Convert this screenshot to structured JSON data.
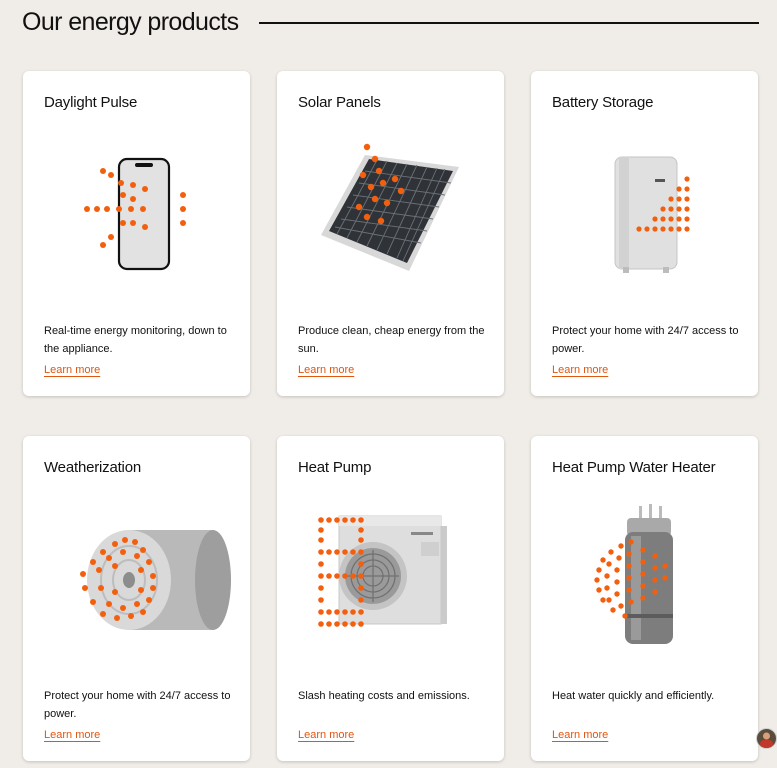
{
  "header": {
    "title": "Our energy products"
  },
  "colors": {
    "accent": "#f2600f",
    "link": "#e0560f",
    "background": "#f0ede8"
  },
  "products": [
    {
      "title": "Daylight Pulse",
      "description": "Real-time energy monitoring, down to the appliance.",
      "link": "Learn more",
      "icon": "phone-icon"
    },
    {
      "title": "Solar Panels",
      "description": "Produce clean, cheap energy from the sun.",
      "link": "Learn more",
      "icon": "solar-panel-icon"
    },
    {
      "title": "Battery Storage",
      "description": "Protect your home with 24/7 access to power.",
      "link": "Learn more",
      "icon": "battery-icon"
    },
    {
      "title": "Weatherization",
      "description": "Protect your home with 24/7 access to power.",
      "link": "Learn more",
      "icon": "insulation-roll-icon"
    },
    {
      "title": "Heat Pump",
      "description": "Slash heating costs and emissions.",
      "link": "Learn more",
      "icon": "heat-pump-icon"
    },
    {
      "title": "Heat Pump Water Heater",
      "description": "Heat water quickly and efficiently.",
      "link": "Learn more",
      "icon": "water-heater-icon"
    }
  ]
}
